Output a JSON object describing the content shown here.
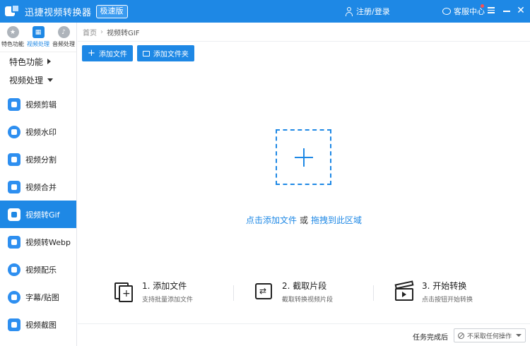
{
  "app": {
    "title": "迅捷视频转换器",
    "badge": "极速版",
    "login": "注册/登录",
    "service": "客服中心",
    "accent_color": "#1e88e5"
  },
  "sidebar": {
    "categories": [
      {
        "label": "特色功能",
        "icon": "star-icon"
      },
      {
        "label": "视频处理",
        "icon": "film-icon"
      },
      {
        "label": "音频处理",
        "icon": "audio-icon"
      }
    ],
    "groups": [
      "特色功能",
      "视频处理"
    ],
    "items": [
      {
        "label": "视频剪辑",
        "icon": "video-edit-icon"
      },
      {
        "label": "视频水印",
        "icon": "watermark-icon"
      },
      {
        "label": "视频分割",
        "icon": "split-icon"
      },
      {
        "label": "视频合并",
        "icon": "merge-icon"
      },
      {
        "label": "视频转Gif",
        "icon": "gif-icon"
      },
      {
        "label": "视频转Webp",
        "icon": "webp-icon"
      },
      {
        "label": "视频配乐",
        "icon": "music-icon"
      },
      {
        "label": "字幕/贴图",
        "icon": "subtitle-icon"
      },
      {
        "label": "视频截图",
        "icon": "screenshot-icon"
      }
    ]
  },
  "breadcrumb": {
    "home": "首页",
    "current": "视频转GIF"
  },
  "toolbar": {
    "add_file": "添加文件",
    "add_folder": "添加文件夹"
  },
  "drop": {
    "click_add": "点击添加文件",
    "or": "或",
    "drag": "拖拽到此区域"
  },
  "steps": [
    {
      "title": "1. 添加文件",
      "desc": "支持批量添加文件"
    },
    {
      "title": "2. 截取片段",
      "desc": "截取转换视频片段"
    },
    {
      "title": "3. 开始转换",
      "desc": "点击按钮开始转换"
    }
  ],
  "status": {
    "after_label": "任务完成后",
    "after_value": "不采取任何操作"
  }
}
